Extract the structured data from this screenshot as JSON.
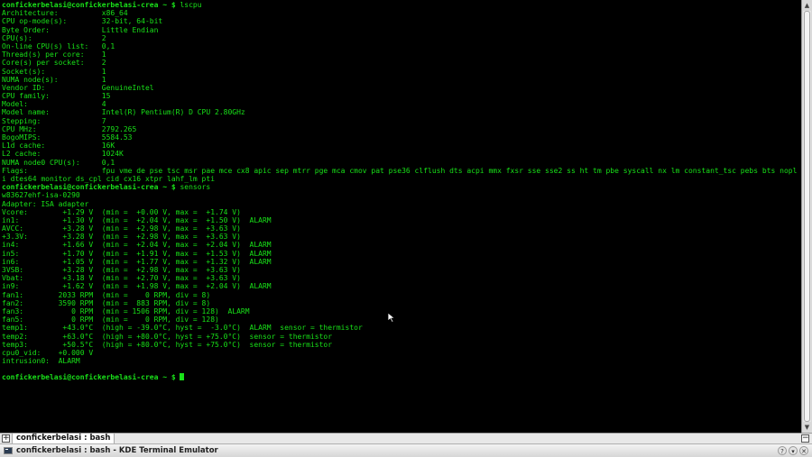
{
  "terminal": {
    "prompt": "confickerbelasi@confickerbelasi-crea ~ $",
    "lines": [
      {
        "kind": "prompt",
        "cmd": " lscpu"
      },
      {
        "kind": "out",
        "text": "Architecture:          x86_64"
      },
      {
        "kind": "out",
        "text": "CPU op-mode(s):        32-bit, 64-bit"
      },
      {
        "kind": "out",
        "text": "Byte Order:            Little Endian"
      },
      {
        "kind": "out",
        "text": "CPU(s):                2"
      },
      {
        "kind": "out",
        "text": "On-line CPU(s) list:   0,1"
      },
      {
        "kind": "out",
        "text": "Thread(s) per core:    1"
      },
      {
        "kind": "out",
        "text": "Core(s) per socket:    2"
      },
      {
        "kind": "out",
        "text": "Socket(s):             1"
      },
      {
        "kind": "out",
        "text": "NUMA node(s):          1"
      },
      {
        "kind": "out",
        "text": "Vendor ID:             GenuineIntel"
      },
      {
        "kind": "out",
        "text": "CPU family:            15"
      },
      {
        "kind": "out",
        "text": "Model:                 4"
      },
      {
        "kind": "out",
        "text": "Model name:            Intel(R) Pentium(R) D CPU 2.80GHz"
      },
      {
        "kind": "out",
        "text": "Stepping:              7"
      },
      {
        "kind": "out",
        "text": "CPU MHz:               2792.265"
      },
      {
        "kind": "out",
        "text": "BogoMIPS:              5584.53"
      },
      {
        "kind": "out",
        "text": "L1d cache:             16K"
      },
      {
        "kind": "out",
        "text": "L2 cache:              1024K"
      },
      {
        "kind": "out",
        "text": "NUMA node0 CPU(s):     0,1"
      },
      {
        "kind": "out",
        "text": "Flags:                 fpu vme de pse tsc msr pae mce cx8 apic sep mtrr pge mca cmov pat pse36 clflush dts acpi mmx fxsr sse sse2 ss ht tm pbe syscall nx lm constant_tsc pebs bts nopl cpuid pn"
      },
      {
        "kind": "out",
        "text": "i dtes64 monitor ds_cpl cid cx16 xtpr lahf_lm pti"
      },
      {
        "kind": "prompt",
        "cmd": " sensors"
      },
      {
        "kind": "out",
        "text": "w83627ehf-isa-0290"
      },
      {
        "kind": "out",
        "text": "Adapter: ISA adapter"
      },
      {
        "kind": "out",
        "text": "Vcore:        +1.29 V  (min =  +0.00 V, max =  +1.74 V)"
      },
      {
        "kind": "out",
        "text": "in1:          +1.30 V  (min =  +2.04 V, max =  +1.50 V)  ALARM"
      },
      {
        "kind": "out",
        "text": "AVCC:         +3.28 V  (min =  +2.98 V, max =  +3.63 V)"
      },
      {
        "kind": "out",
        "text": "+3.3V:        +3.28 V  (min =  +2.98 V, max =  +3.63 V)"
      },
      {
        "kind": "out",
        "text": "in4:          +1.66 V  (min =  +2.04 V, max =  +2.04 V)  ALARM"
      },
      {
        "kind": "out",
        "text": "in5:          +1.70 V  (min =  +1.91 V, max =  +1.53 V)  ALARM"
      },
      {
        "kind": "out",
        "text": "in6:          +1.05 V  (min =  +1.77 V, max =  +1.32 V)  ALARM"
      },
      {
        "kind": "out",
        "text": "3VSB:         +3.28 V  (min =  +2.98 V, max =  +3.63 V)"
      },
      {
        "kind": "out",
        "text": "Vbat:         +3.18 V  (min =  +2.70 V, max =  +3.63 V)"
      },
      {
        "kind": "out",
        "text": "in9:          +1.62 V  (min =  +1.98 V, max =  +2.04 V)  ALARM"
      },
      {
        "kind": "out",
        "text": "fan1:        2033 RPM  (min =    0 RPM, div = 8)"
      },
      {
        "kind": "out",
        "text": "fan2:        3590 RPM  (min =  883 RPM, div = 8)"
      },
      {
        "kind": "out",
        "text": "fan3:           0 RPM  (min = 1506 RPM, div = 128)  ALARM"
      },
      {
        "kind": "out",
        "text": "fan5:           0 RPM  (min =    0 RPM, div = 128)"
      },
      {
        "kind": "out",
        "text": "temp1:        +43.0°C  (high = -39.0°C, hyst =  -3.0°C)  ALARM  sensor = thermistor"
      },
      {
        "kind": "out",
        "text": "temp2:        +63.0°C  (high = +80.0°C, hyst = +75.0°C)  sensor = thermistor"
      },
      {
        "kind": "out",
        "text": "temp3:        +50.5°C  (high = +80.0°C, hyst = +75.0°C)  sensor = thermistor"
      },
      {
        "kind": "out",
        "text": "cpu0_vid:    +0.000 V"
      },
      {
        "kind": "out",
        "text": "intrusion0:  ALARM"
      },
      {
        "kind": "out",
        "text": ""
      },
      {
        "kind": "prompt",
        "cmd": " ",
        "cursor": true
      }
    ]
  },
  "tabbar": {
    "new_tab_glyph": "+",
    "tab_label": "confickerbelasi : bash",
    "close_tab_glyph": "−"
  },
  "taskbar": {
    "window_title": "confickerbelasi : bash - KDE Terminal Emulator",
    "buttons": [
      "?",
      "▾",
      "✕"
    ]
  },
  "colors": {
    "terminal_bg": "#000000",
    "terminal_fg": "#18e118",
    "chrome_bg": "#e8e8e8"
  },
  "icons": [
    "new-tab-icon",
    "close-tab-icon",
    "terminal-app-icon",
    "mouse-pointer-icon"
  ]
}
